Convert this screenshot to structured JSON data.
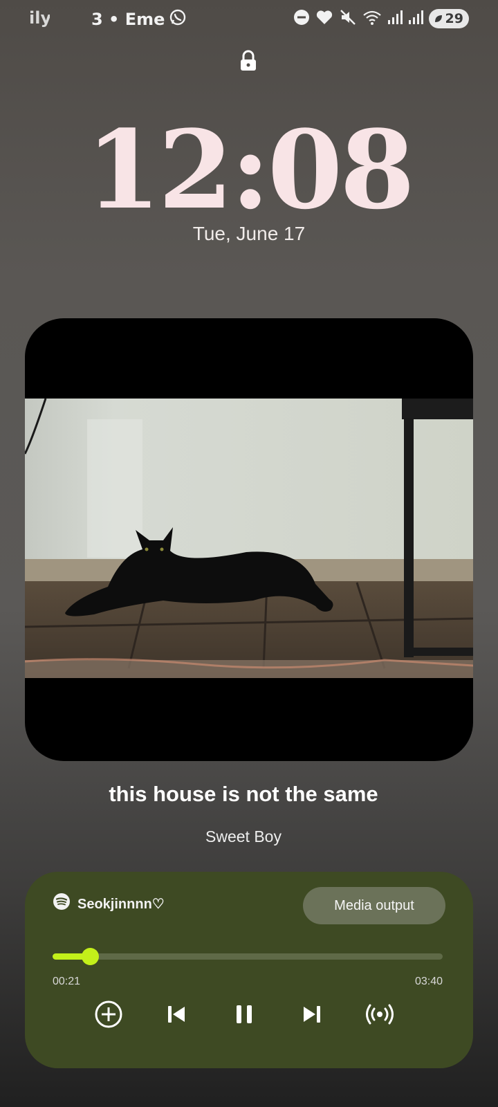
{
  "status_bar": {
    "left_fragment": "ily",
    "notification_text": "3 • Eme",
    "icons": [
      "dnd-icon",
      "heart-icon",
      "mute-icon",
      "wifi-icon",
      "signal-icon",
      "signal-icon"
    ],
    "battery": "29"
  },
  "lock": {
    "icon": "lock-icon"
  },
  "clock": {
    "time": "12:08",
    "date": "Tue, June 17"
  },
  "now_playing": {
    "title": "this house is not the same",
    "artist": "Sweet Boy"
  },
  "player": {
    "app_icon": "spotify-icon",
    "source_name": "Seokjinnnn♡",
    "media_output_label": "Media output",
    "elapsed": "00:21",
    "duration": "03:40",
    "progress_fraction": 0.095,
    "accent_color": "#c3f01a",
    "controls": [
      "add-icon",
      "previous-icon",
      "pause-icon",
      "next-icon",
      "broadcast-icon"
    ]
  }
}
